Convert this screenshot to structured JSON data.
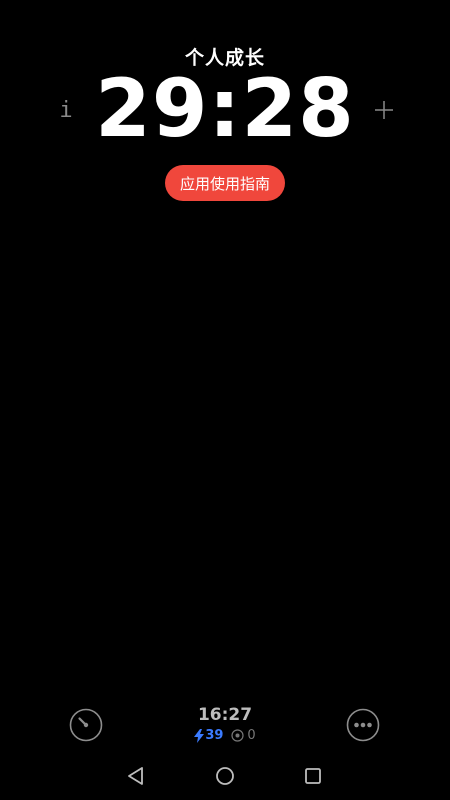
{
  "header": {
    "title": "个人成长",
    "timer": "29:28",
    "info_label": "i",
    "add_label": "+"
  },
  "guide_button": {
    "label": "应用使用指南",
    "color": "#f0473c"
  },
  "footer": {
    "clock": "16:27",
    "energy": "39",
    "coins": "0",
    "energy_color": "#3b7bff",
    "left_icon": "timer-icon",
    "right_icon": "more-icon"
  },
  "nav": {
    "icons": [
      "back-icon",
      "home-icon",
      "recent-apps-icon"
    ]
  }
}
